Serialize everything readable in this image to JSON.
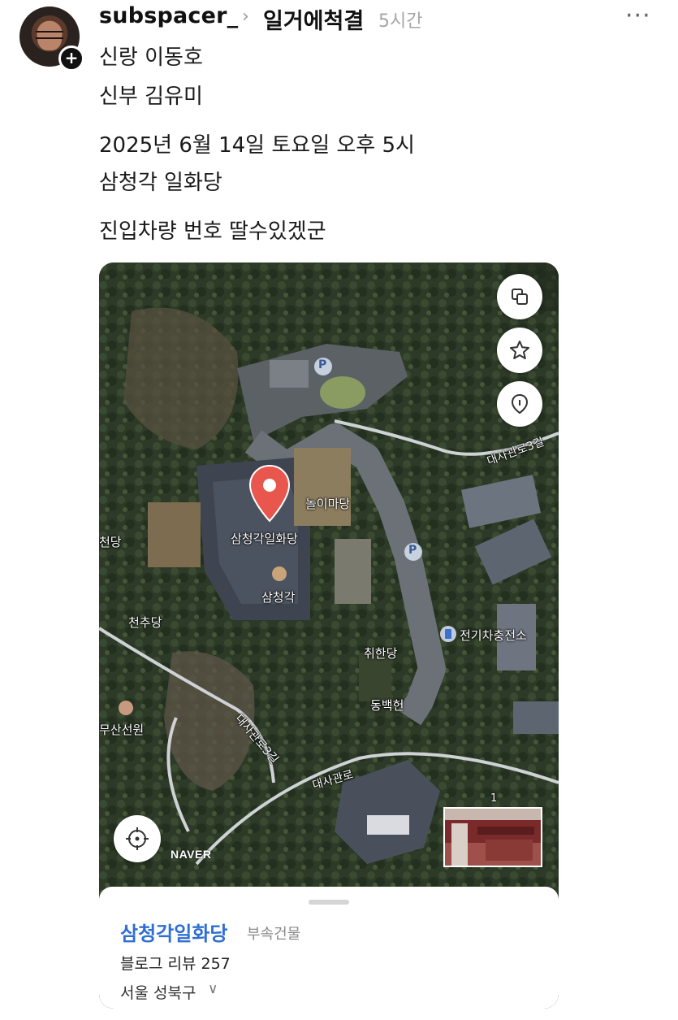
{
  "header": {
    "username": "subspacer_",
    "community": "일거에척결",
    "time": "5시간"
  },
  "post": {
    "lines": [
      "신랑 이동호",
      "신부 김유미",
      "2025년 6월 14일 토요일 오후 5시",
      "삼청각 일화당",
      "진입차량 번호 딸수있겠군"
    ]
  },
  "map": {
    "labels": {
      "nori_madang": "놀이마당",
      "samcheonggak_ilhwadang": "삼청각일화당",
      "samcheonggak": "삼청각",
      "cheondang": "천당",
      "cheonchudang": "천추당",
      "ev_charger": "전기차충전소",
      "chwihandang": "취한당",
      "dongbaekheon": "동백헌",
      "musanseonwon": "무산선원",
      "road_daesagwan_3gil_top": "대사관로3길",
      "road_daesagwan_3gil_mid": "대사관로3길",
      "road_daesagwan": "대사관로",
      "parking": "P",
      "badge_1": "1"
    },
    "logo": "NAVER",
    "icons": [
      "layers-icon",
      "star-icon",
      "place-pin-icon",
      "locate-icon",
      "map-marker-icon"
    ]
  },
  "place": {
    "name": "삼청각일화당",
    "category": "부속건물",
    "reviews": "블로그 리뷰 257",
    "address": "서울 성북구"
  },
  "colors": {
    "place_name": "#2f6fd3",
    "marker": "#e8564d",
    "road": "#cfd2d5"
  }
}
